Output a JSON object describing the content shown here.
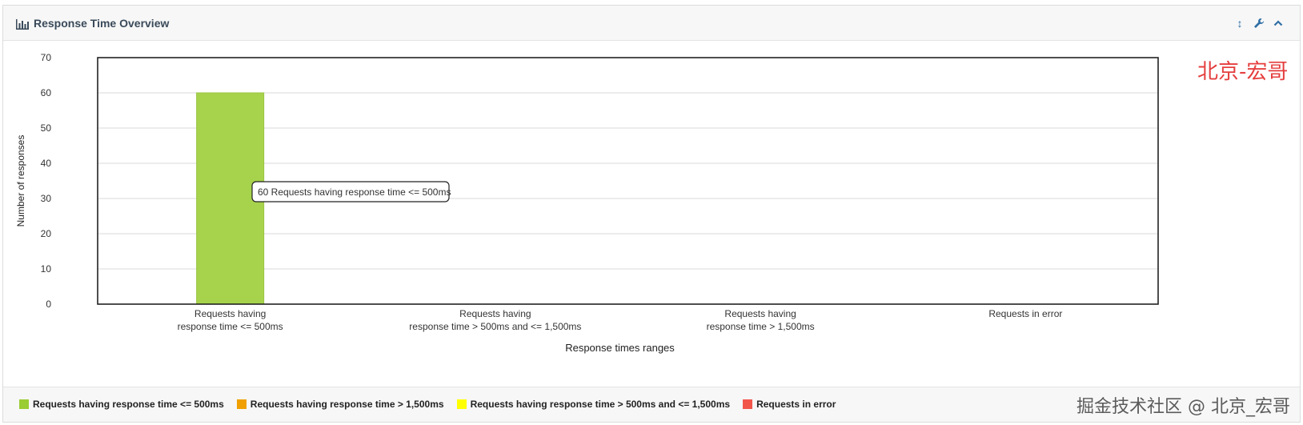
{
  "header": {
    "title": "Response Time Overview",
    "title_icon": "bar-chart-icon",
    "tools": [
      {
        "name": "resize-arrows-icon",
        "glyph": "↕"
      },
      {
        "name": "wrench-icon",
        "glyph": "🔧"
      },
      {
        "name": "collapse-chevron-icon",
        "glyph": "⌃"
      }
    ]
  },
  "watermark_top": "北京-宏哥",
  "watermark_bottom": "掘金技术社区 @ 北京_宏哥",
  "tooltip": "60 Requests having response time <= 500ms",
  "chart_data": {
    "type": "bar",
    "title": "",
    "xlabel": "Response times ranges",
    "ylabel": "Number of responses",
    "ylim": [
      0,
      70
    ],
    "yticks": [
      0,
      10,
      20,
      30,
      40,
      50,
      60,
      70
    ],
    "grid": true,
    "categories": [
      [
        "Requests having",
        "response time <= 500ms"
      ],
      [
        "Requests having",
        "response time > 500ms and <= 1,500ms"
      ],
      [
        "Requests having",
        "response time > 1,500ms"
      ],
      [
        "Requests in error"
      ]
    ],
    "values": [
      60,
      0,
      0,
      0
    ],
    "bar_colors": [
      "#a7d34c",
      "#ffff00",
      "#f0a000",
      "#f2564b"
    ],
    "legend_placement": "bottom",
    "legend": [
      {
        "label": "Requests having response time <= 500ms",
        "color": "#9acd32"
      },
      {
        "label": "Requests having response time > 1,500ms",
        "color": "#f0a000"
      },
      {
        "label": "Requests having response time > 500ms and <= 1,500ms",
        "color": "#ffff00"
      },
      {
        "label": "Requests in error",
        "color": "#f2564b"
      }
    ]
  }
}
